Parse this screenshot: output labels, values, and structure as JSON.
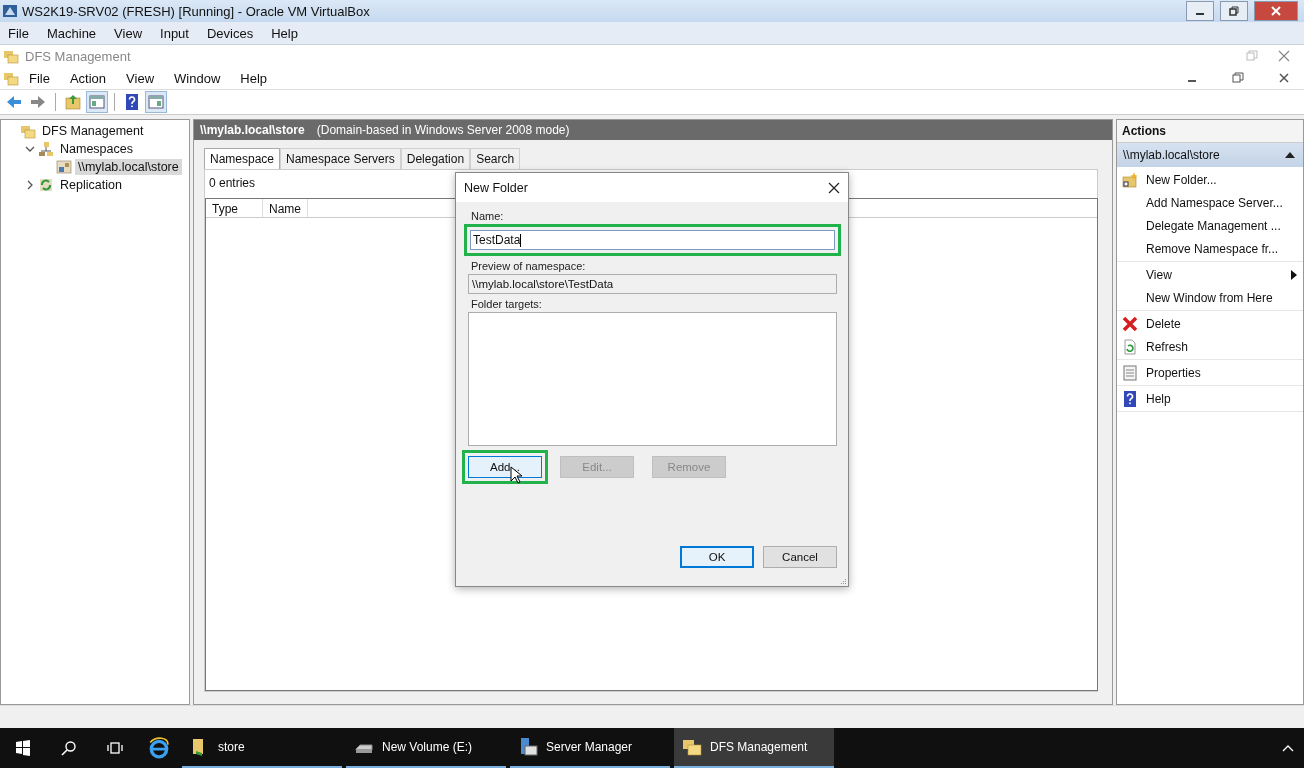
{
  "vm_window": {
    "title": "WS2K19-SRV02 (FRESH) [Running] - Oracle VM VirtualBox",
    "menu": [
      "File",
      "Machine",
      "View",
      "Input",
      "Devices",
      "Help"
    ]
  },
  "mmc_window": {
    "title": "DFS Management",
    "menu": [
      "File",
      "Action",
      "View",
      "Window",
      "Help"
    ]
  },
  "tree": [
    {
      "label": "DFS Management",
      "kind": "root",
      "selected": false,
      "children": [
        {
          "label": "Namespaces",
          "kind": "namespaces",
          "expanded": true,
          "selected": false,
          "children": [
            {
              "label": "\\\\mylab.local\\store",
              "kind": "namespace",
              "selected": true
            }
          ]
        },
        {
          "label": "Replication",
          "kind": "replication",
          "expanded": false,
          "selected": false
        }
      ]
    }
  ],
  "details": {
    "path": "\\\\mylab.local\\store",
    "description": "(Domain-based in Windows Server 2008 mode)",
    "tabs": [
      {
        "label": "Namespace",
        "selected": true
      },
      {
        "label": "Namespace Servers",
        "selected": false
      },
      {
        "label": "Delegation",
        "selected": false
      },
      {
        "label": "Search",
        "selected": false
      }
    ],
    "entries": "0 entries",
    "columns": [
      "Type",
      "Name"
    ]
  },
  "actions": {
    "title": "Actions",
    "section": "\\\\mylab.local\\store",
    "groups": [
      [
        {
          "label": "New Folder...",
          "kind": "new_folder",
          "submenu": false
        },
        {
          "label": "Add Namespace Server...",
          "kind": "plain",
          "submenu": false
        },
        {
          "label": "Delegate Management ...",
          "kind": "plain",
          "submenu": false
        },
        {
          "label": "Remove Namespace fr...",
          "kind": "plain",
          "submenu": false
        }
      ],
      [
        {
          "label": "View",
          "kind": "plain",
          "submenu": true
        },
        {
          "label": "New Window from Here",
          "kind": "plain",
          "submenu": false
        }
      ],
      [
        {
          "label": "Delete",
          "kind": "delete",
          "submenu": false
        },
        {
          "label": "Refresh",
          "kind": "refresh",
          "submenu": false
        }
      ],
      [
        {
          "label": "Properties",
          "kind": "properties",
          "submenu": false
        }
      ],
      [
        {
          "label": "Help",
          "kind": "help",
          "submenu": false
        }
      ]
    ]
  },
  "dialog": {
    "title": "New Folder",
    "name_label": "Name:",
    "name_value": "TestData",
    "name_highlighted": true,
    "preview_label": "Preview of namespace:",
    "preview_value": "\\\\mylab.local\\store\\TestData",
    "targets_label": "Folder targets:",
    "target_buttons": [
      {
        "label": "Add...",
        "disabled": false,
        "highlighted": true
      },
      {
        "label": "Edit...",
        "disabled": true,
        "highlighted": false
      },
      {
        "label": "Remove",
        "disabled": true,
        "highlighted": false
      }
    ],
    "footer_buttons": [
      {
        "label": "OK",
        "default": true
      },
      {
        "label": "Cancel",
        "default": false
      }
    ]
  },
  "taskbar": {
    "items": [
      {
        "label": "store",
        "kind": "folder",
        "selected": false
      },
      {
        "label": "New Volume (E:)",
        "kind": "drive",
        "selected": false
      },
      {
        "label": "Server Manager",
        "kind": "server",
        "selected": false
      },
      {
        "label": "DFS Management",
        "kind": "dfs",
        "selected": true
      }
    ]
  }
}
